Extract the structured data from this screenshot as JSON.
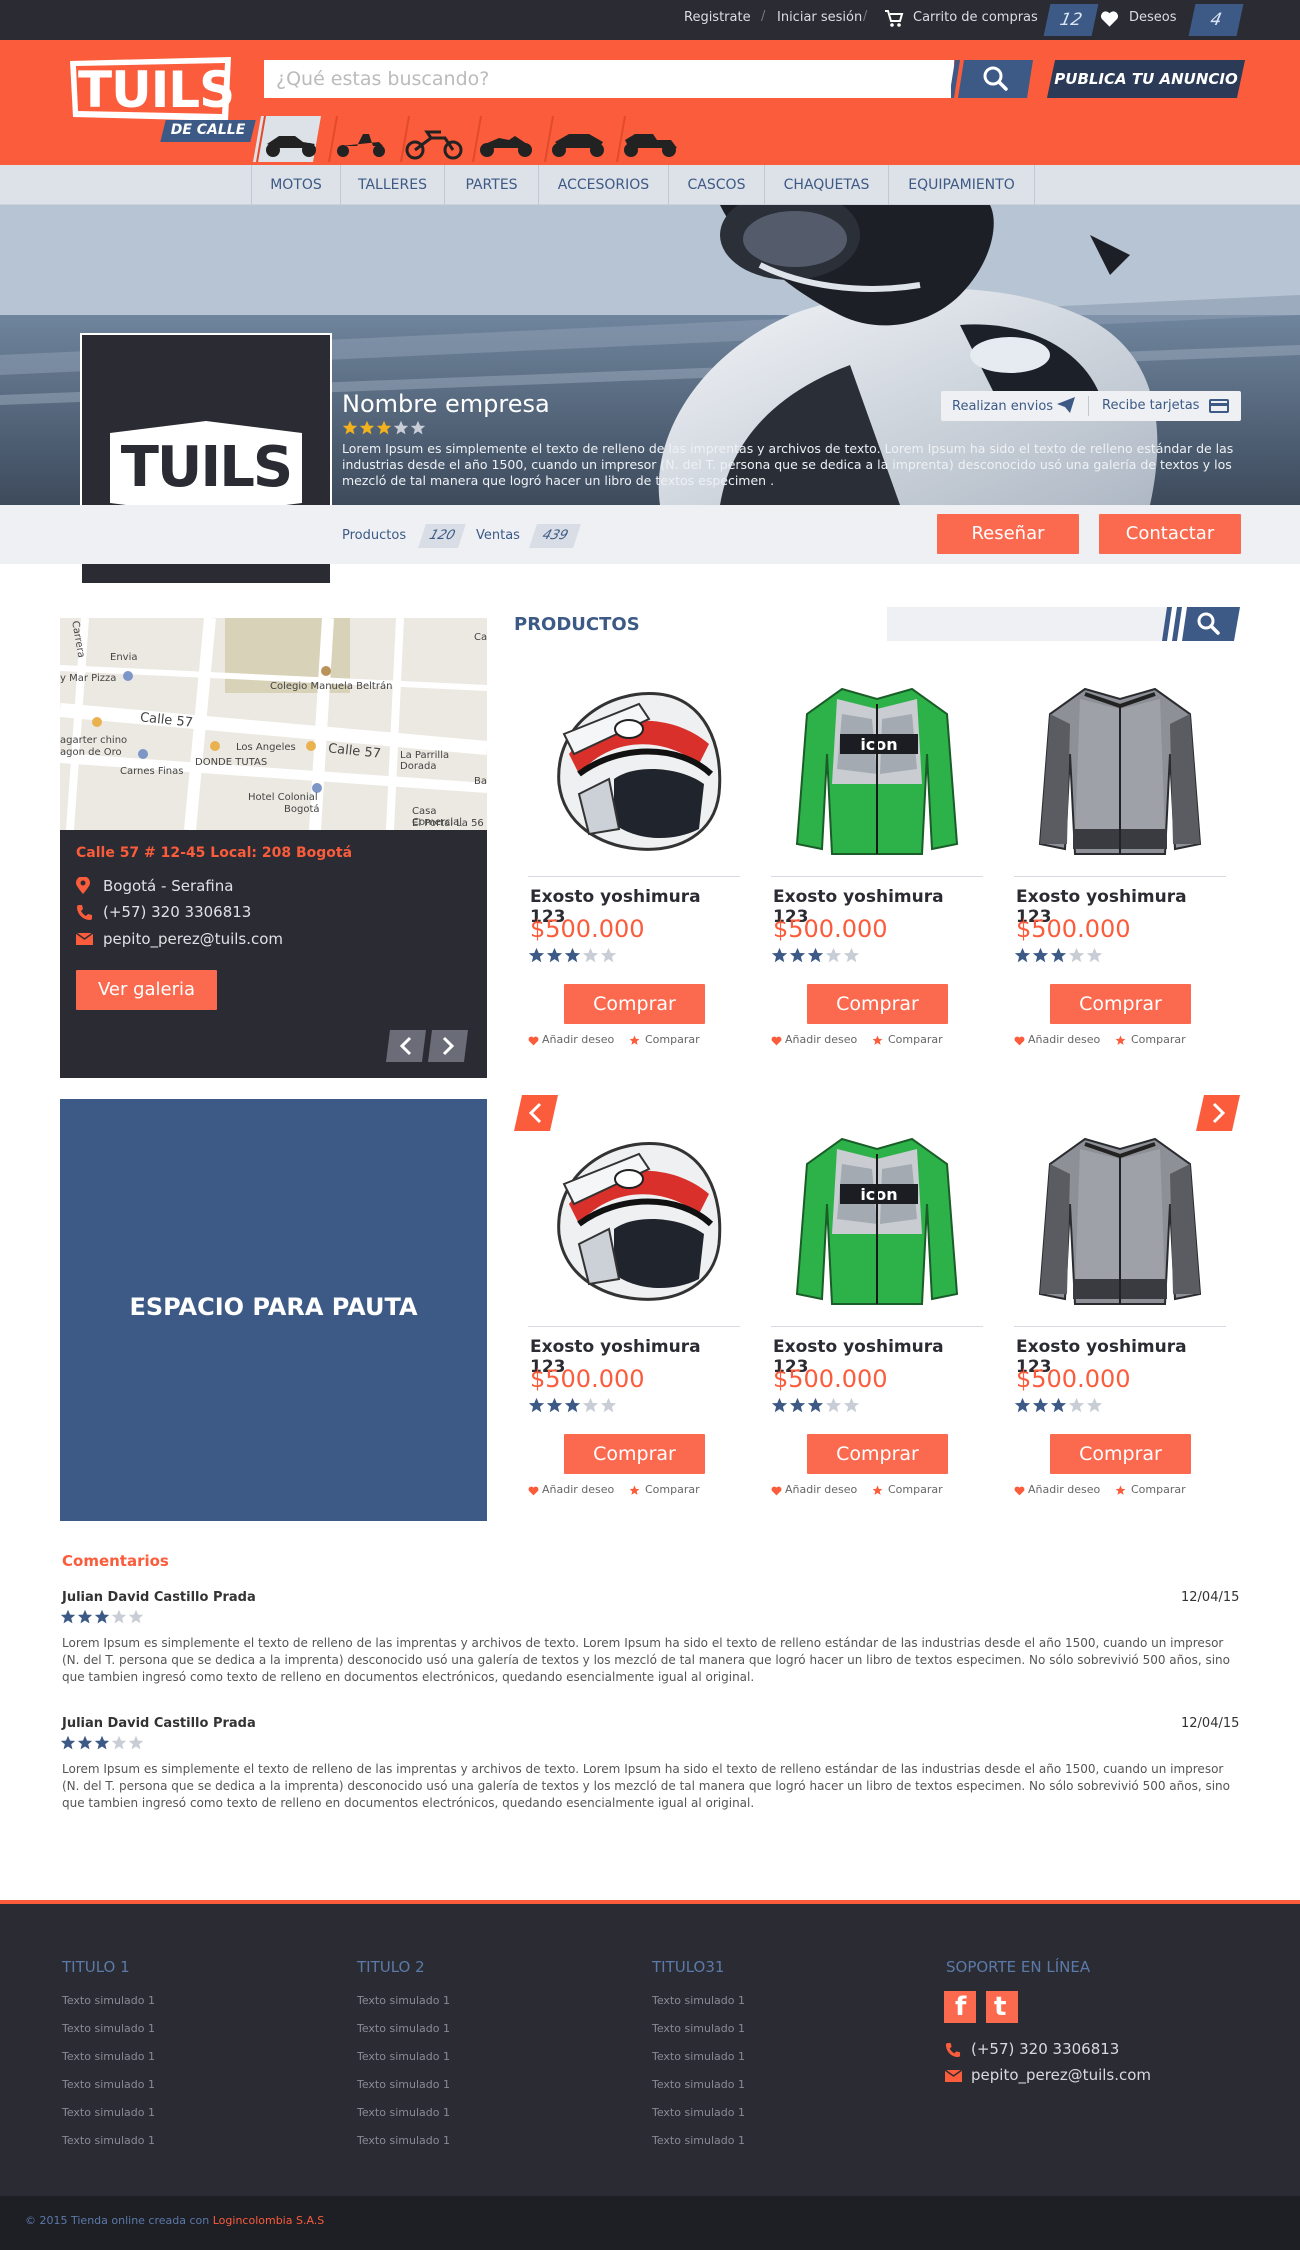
{
  "top_bar": {
    "register": "Registrate",
    "login": "Iniciar sesión",
    "cart_label": "Carrito de compras",
    "cart_count": "12",
    "wishlist_label": "Deseos",
    "wishlist_count": "4"
  },
  "header": {
    "logo_text": "TUILS",
    "logo_subtitle": "DE CALLE",
    "search_placeholder": "¿Qué estas buscando?",
    "publish_button": "PUBLICA TU ANUNCIO",
    "moto_categories": [
      "scooter-icon",
      "cruiser-icon",
      "dirt-bike-icon",
      "chopper-icon",
      "sport-bike-icon",
      "touring-bike-icon"
    ]
  },
  "nav": {
    "items": [
      "MOTOS",
      "TALLERES",
      "PARTES",
      "ACCESORIOS",
      "CASCOS",
      "CHAQUETAS",
      "EQUIPAMIENTO"
    ]
  },
  "store": {
    "name": "Nombre empresa",
    "rating": 3,
    "rating_max": 5,
    "description": "Lorem Ipsum es simplemente el texto de relleno de las imprentas y archivos de texto. Lorem Ipsum ha sido el texto de relleno estándar de las industrias desde el año 1500, cuando un impresor (N. del T. persona que se dedica a la imprenta) desconocido usó una galería de textos y los mezcló de tal manera que logró hacer un libro de textos especimen  .",
    "badge_shipping": "Realizan envios",
    "badge_cards": "Recibe tarjetas",
    "products_label": "Productos",
    "products_count": "120",
    "sales_label": "Ventas",
    "sales_count": "439",
    "review_button": "Reseñar",
    "contact_button": "Contactar",
    "logo_text": "TUILS"
  },
  "map": {
    "labels": [
      "Carrera",
      "Envia",
      "y Mar Pizza",
      "Colegio Manuela Beltrán",
      "Calle 57",
      "Calle 57",
      "Los Angeles",
      "La Parrilla Dorada",
      "agarter chino",
      "agon de Oro",
      "Carnes Finas",
      "DONDE TUTAS",
      "Hotel Colonial",
      "Bogotá",
      "Casa Comercial",
      "El Portal La 56",
      "Ca",
      "Ba"
    ]
  },
  "contact": {
    "address": "Calle 57 # 12-45 Local: 208 Bogotá",
    "city": "Bogotá - Serafina",
    "phone": "(+57) 320 3306813",
    "email": "pepito_perez@tuils.com",
    "gallery_button": "Ver galeria"
  },
  "ad_space": {
    "label": "ESPACIO PARA PAUTA"
  },
  "products": {
    "title": "PRODUCTOS",
    "items": [
      {
        "name": "Exosto yoshimura 123",
        "price": "$500.000",
        "rating": 3,
        "buy": "Comprar",
        "wish": "Añadir deseo",
        "compare": "Comparar",
        "image": "helmet"
      },
      {
        "name": "Exosto yoshimura 123",
        "price": "$500.000",
        "rating": 3,
        "buy": "Comprar",
        "wish": "Añadir deseo",
        "compare": "Comparar",
        "image": "green-jacket"
      },
      {
        "name": "Exosto yoshimura 123",
        "price": "$500.000",
        "rating": 3,
        "buy": "Comprar",
        "wish": "Añadir deseo",
        "compare": "Comparar",
        "image": "grey-jacket"
      },
      {
        "name": "Exosto yoshimura 123",
        "price": "$500.000",
        "rating": 3,
        "buy": "Comprar",
        "wish": "Añadir deseo",
        "compare": "Comparar",
        "image": "helmet"
      },
      {
        "name": "Exosto yoshimura 123",
        "price": "$500.000",
        "rating": 3,
        "buy": "Comprar",
        "wish": "Añadir deseo",
        "compare": "Comparar",
        "image": "green-jacket"
      },
      {
        "name": "Exosto yoshimura 123",
        "price": "$500.000",
        "rating": 3,
        "buy": "Comprar",
        "wish": "Añadir deseo",
        "compare": "Comparar",
        "image": "grey-jacket"
      }
    ]
  },
  "comments": {
    "title": "Comentarios",
    "items": [
      {
        "author": "Julian David Castillo Prada",
        "date": "12/04/15",
        "rating": 3,
        "text": "Lorem Ipsum es simplemente el texto de relleno de las imprentas y archivos de texto. Lorem Ipsum ha sido el texto de relleno estándar de las industrias desde el año 1500, cuando un impresor (N. del T. persona que se dedica a la imprenta) desconocido usó una galería de textos y los mezcló de tal manera que logró hacer un libro de textos especimen. No sólo sobrevivió 500 años, sino que tambien ingresó como texto de relleno en documentos electrónicos, quedando esencialmente igual al original."
      },
      {
        "author": "Julian David Castillo Prada",
        "date": "12/04/15",
        "rating": 3,
        "text": "Lorem Ipsum es simplemente el texto de relleno de las imprentas y archivos de texto. Lorem Ipsum ha sido el texto de relleno estándar de las industrias desde el año 1500, cuando un impresor (N. del T. persona que se dedica a la imprenta) desconocido usó una galería de textos y los mezcló de tal manera que logró hacer un libro de textos especimen. No sólo sobrevivió 500 años, sino que tambien ingresó como texto de relleno en documentos electrónicos, quedando esencialmente igual al original."
      }
    ]
  },
  "footer": {
    "columns": [
      {
        "title": "TITULO 1",
        "links": [
          "Texto simulado 1",
          "Texto simulado 1",
          "Texto simulado 1",
          "Texto simulado 1",
          "Texto simulado 1",
          "Texto simulado 1"
        ]
      },
      {
        "title": "TITULO 2",
        "links": [
          "Texto simulado 1",
          "Texto simulado 1",
          "Texto simulado 1",
          "Texto simulado 1",
          "Texto simulado 1",
          "Texto simulado 1"
        ]
      },
      {
        "title": "TITULO31",
        "links": [
          "Texto simulado 1",
          "Texto simulado 1",
          "Texto simulado 1",
          "Texto simulado 1",
          "Texto simulado 1",
          "Texto simulado 1"
        ]
      }
    ],
    "support_title": "SOPORTE EN LÍNEA",
    "phone": "(+57) 320 3306813",
    "email": "pepito_perez@tuils.com",
    "copyright_prefix": "© 2015 Tienda online creada con ",
    "copyright_link": "Logincolombia S.A.S"
  },
  "colors": {
    "brand_orange": "#fb5c3b",
    "brand_blue": "#3c5a85",
    "dark": "#2b2b33"
  }
}
